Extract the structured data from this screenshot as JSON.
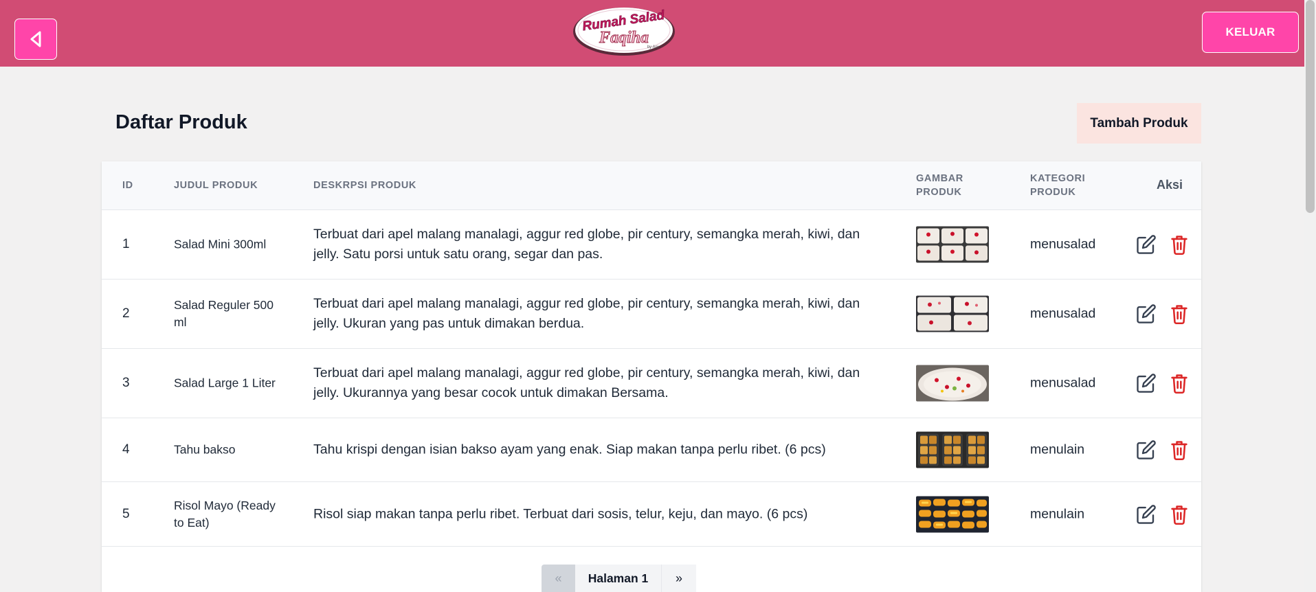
{
  "header": {
    "logo_line1": "Rumah Salad",
    "logo_line2": "Faqiha",
    "logo_tag": "by Ani",
    "logout_label": "KELUAR"
  },
  "page": {
    "title": "Daftar Produk",
    "add_label": "Tambah Produk"
  },
  "table": {
    "headers": {
      "id": "ID",
      "title": "JUDUL PRODUK",
      "desc": "DESKRPSI PRODUK",
      "image_l1": "GAMBAR",
      "image_l2": "PRODUK",
      "cat_l1": "KATEGORI",
      "cat_l2": "PRODUK",
      "action": "Aksi"
    },
    "rows": [
      {
        "id": "1",
        "title": "Salad Mini 300ml",
        "desc": "Terbuat dari apel malang manalagi, aggur red globe, pir century, semangka merah, kiwi, dan jelly. Satu porsi untuk satu orang, segar dan pas.",
        "category": "menusalad"
      },
      {
        "id": "2",
        "title": "Salad Reguler 500 ml",
        "desc": "Terbuat dari apel malang manalagi, aggur red globe, pir century, semangka merah, kiwi, dan jelly. Ukuran yang pas untuk dimakan berdua.",
        "category": "menusalad"
      },
      {
        "id": "3",
        "title": "Salad Large 1 Liter",
        "desc": "Terbuat dari apel malang manalagi, aggur red globe, pir century, semangka merah, kiwi, dan jelly. Ukurannya yang besar cocok untuk dimakan Bersama.",
        "category": "menusalad"
      },
      {
        "id": "4",
        "title": "Tahu bakso",
        "desc": "Tahu krispi dengan isian bakso ayam yang enak. Siap makan tanpa perlu ribet. (6 pcs)",
        "category": "menulain"
      },
      {
        "id": "5",
        "title": "Risol Mayo (Ready to Eat)",
        "desc": "Risol siap makan tanpa perlu ribet. Terbuat dari sosis, telur, keju, dan mayo. (6 pcs)",
        "category": "menulain"
      }
    ]
  },
  "pagination": {
    "prev": "«",
    "current": "Halaman 1",
    "next": "»"
  },
  "colors": {
    "header_bg": "#d14c74",
    "button_pink": "#ff45a9",
    "add_button_bg": "#fbe4e0",
    "delete_red": "#dc2626"
  },
  "icons": [
    "back-arrow-icon",
    "edit-icon",
    "trash-icon"
  ]
}
